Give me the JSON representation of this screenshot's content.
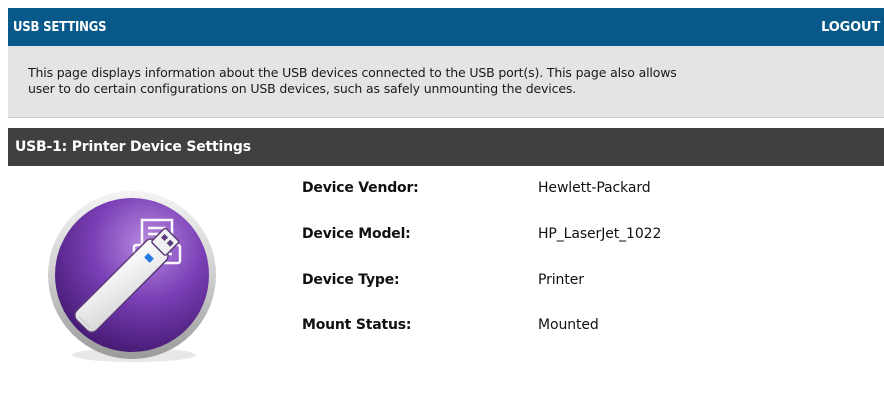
{
  "header": {
    "title": "USB SETTINGS",
    "logout_label": "LOGOUT",
    "background_color": "#08598a"
  },
  "info": {
    "line1": "This page displays information about the USB devices connected to the USB port(s). This page also allows",
    "line2": "user to do certain configurations on USB devices, such as safely unmounting the devices."
  },
  "section": {
    "title": "USB-1: Printer Device Settings",
    "background_color": "#404040"
  },
  "device": {
    "icon": "usb-printer-icon",
    "properties": [
      {
        "label": "Device Vendor:",
        "value": "Hewlett-Packard"
      },
      {
        "label": "Device Model:",
        "value": "HP_LaserJet_1022"
      },
      {
        "label": "Device Type:",
        "value": "Printer"
      },
      {
        "label": "Mount Status:",
        "value": "Mounted"
      }
    ]
  }
}
